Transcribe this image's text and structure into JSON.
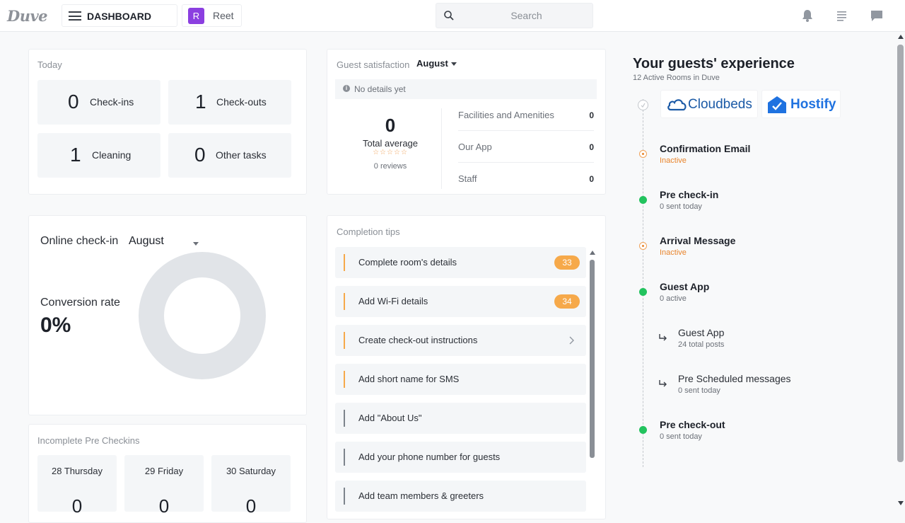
{
  "header": {
    "logo": "Duve",
    "menu_title": "DASHBOARD",
    "user_initial": "R",
    "user_name": "Reet",
    "search_placeholder": "Search"
  },
  "today": {
    "label": "Today",
    "stats": [
      {
        "value": "0",
        "label": "Check-ins"
      },
      {
        "value": "1",
        "label": "Check-outs"
      },
      {
        "value": "1",
        "label": "Cleaning"
      },
      {
        "value": "0",
        "label": "Other tasks"
      }
    ]
  },
  "guest_satisfaction": {
    "label": "Guest satisfaction",
    "month": "August",
    "no_details": "No details yet",
    "total_value": "0",
    "total_label": "Total average",
    "stars": "☆☆☆☆☆",
    "reviews": "0 reviews",
    "rows": [
      {
        "name": "Facilities and Amenities",
        "value": "0"
      },
      {
        "name": "Our App",
        "value": "0"
      },
      {
        "name": "Staff",
        "value": "0"
      }
    ]
  },
  "online_checkin": {
    "label": "Online check-in",
    "month": "August",
    "conversion_label": "Conversion rate",
    "conversion_value": "0%",
    "conversion_fraction": 0
  },
  "completion_tips": {
    "label": "Completion tips",
    "items": [
      {
        "text": "Complete room's details",
        "badge": "33",
        "accent": "#f6a94a"
      },
      {
        "text": "Add Wi-Fi details",
        "badge": "34",
        "accent": "#f6a94a"
      },
      {
        "text": "Create check-out instructions",
        "badge": "",
        "accent": "#f6a94a"
      },
      {
        "text": "Add short name for SMS",
        "badge": "",
        "accent": "#f6a94a"
      },
      {
        "text": "Add \"About Us\"",
        "badge": "",
        "accent": "#7d848c"
      },
      {
        "text": "Add your phone number for guests",
        "badge": "",
        "accent": "#7d848c"
      },
      {
        "text": "Add team members & greeters",
        "badge": "",
        "accent": "#7d848c"
      }
    ]
  },
  "incomplete_prechecks": {
    "label": "Incomplete Pre Checkins",
    "days": [
      {
        "date": "28 Thursday",
        "count": "0"
      },
      {
        "date": "29 Friday",
        "count": "0"
      },
      {
        "date": "30 Saturday",
        "count": "0"
      }
    ]
  },
  "experience": {
    "title": "Your guests' experience",
    "subtitle": "12 Active Rooms in Duve",
    "brands": [
      "Cloudbeds",
      "Hostify"
    ],
    "steps": [
      {
        "title": "Confirmation Email",
        "status": "Inactive",
        "state": "inactive"
      },
      {
        "title": "Pre check-in",
        "status": "0 sent today",
        "state": "active"
      },
      {
        "title": "Arrival Message",
        "status": "Inactive",
        "state": "inactive"
      },
      {
        "title": "Guest App",
        "status": "0 active",
        "state": "active"
      }
    ],
    "sub_steps": [
      {
        "title": "Guest App",
        "status": "24 total posts"
      },
      {
        "title": "Pre Scheduled messages",
        "status": "0 sent today"
      }
    ],
    "last_step": {
      "title": "Pre check-out",
      "status": "0 sent today",
      "state": "active"
    }
  },
  "colors": {
    "accent_purple": "#8b3fe0",
    "active_green": "#22c35e",
    "inactive_orange": "#e8842c",
    "badge_orange": "#f6a94a"
  }
}
